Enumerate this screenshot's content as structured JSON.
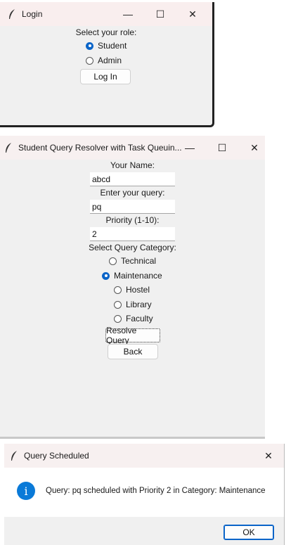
{
  "login": {
    "title": "Login",
    "prompt": "Select your role:",
    "roles": [
      {
        "label": "Student",
        "selected": true
      },
      {
        "label": "Admin",
        "selected": false
      }
    ],
    "login_button": "Log In"
  },
  "resolver": {
    "title": "Student Query Resolver with Task Queuin...",
    "name_label": "Your Name:",
    "name_value": "abcd",
    "query_label": "Enter your query:",
    "query_value": "pq",
    "priority_label": "Priority (1-10):",
    "priority_value": "2",
    "category_label": "Select Query Category:",
    "categories": [
      {
        "label": "Technical",
        "selected": false
      },
      {
        "label": "Maintenance",
        "selected": true
      },
      {
        "label": "Hostel",
        "selected": false
      },
      {
        "label": "Library",
        "selected": false
      },
      {
        "label": "Faculty",
        "selected": false
      }
    ],
    "resolve_button": "Resolve Query",
    "back_button": "Back"
  },
  "dialog": {
    "title": "Query Scheduled",
    "message": "Query: pq scheduled with Priority 2 in Category: Maintenance",
    "ok_button": "OK",
    "info_icon_char": "i"
  },
  "window_controls": {
    "minimize": "—",
    "maximize": "☐",
    "close": "✕"
  },
  "colors": {
    "accent": "#0a64c8",
    "titlebar": "#f9eeee",
    "window_bg": "#f0f0f0"
  }
}
